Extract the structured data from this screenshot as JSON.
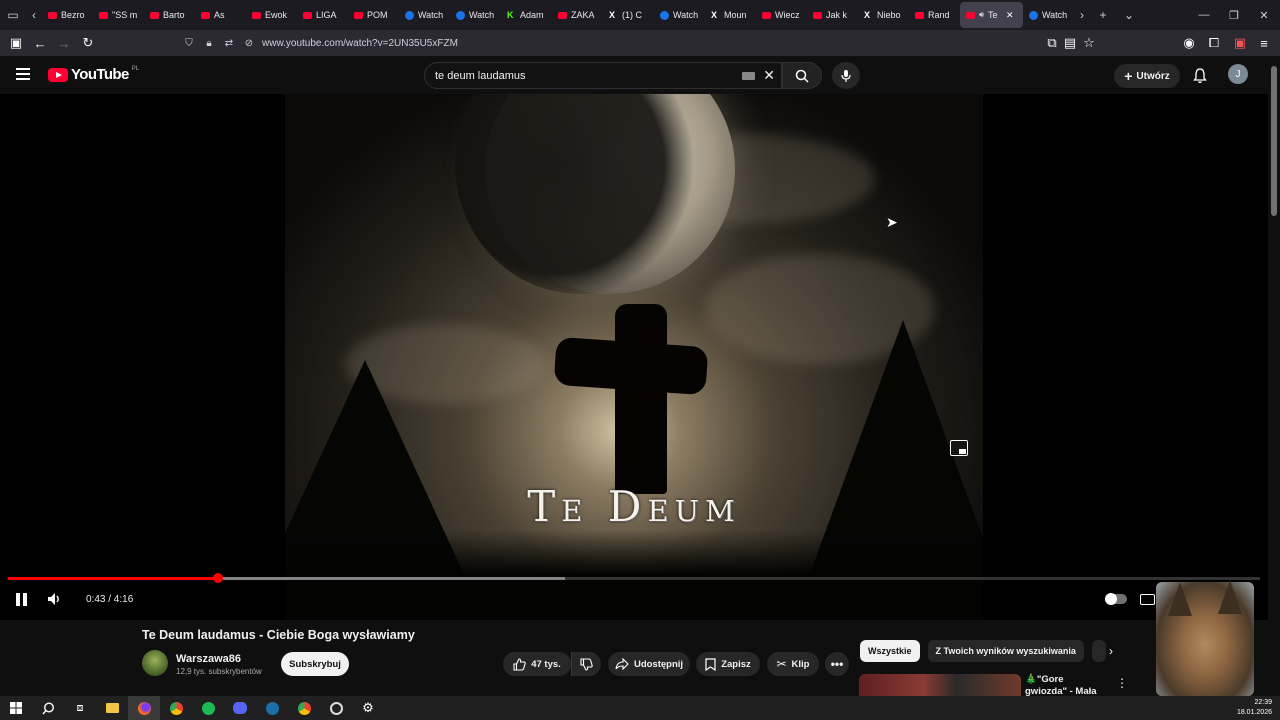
{
  "browser": {
    "tabs": [
      {
        "label": "Bezro",
        "favicon": "yt"
      },
      {
        "label": "\"SS m",
        "favicon": "yt"
      },
      {
        "label": "Barto",
        "favicon": "yt"
      },
      {
        "label": "As",
        "favicon": "yt"
      },
      {
        "label": "Ewok",
        "favicon": "yt"
      },
      {
        "label": "LIGA",
        "favicon": "yt"
      },
      {
        "label": "POM",
        "favicon": "yt"
      },
      {
        "label": "Watch",
        "favicon": "blue"
      },
      {
        "label": "Watch",
        "favicon": "blue"
      },
      {
        "label": "Adam",
        "favicon": "k"
      },
      {
        "label": "ZAKA",
        "favicon": "yt"
      },
      {
        "label": "(1) C",
        "favicon": "x"
      },
      {
        "label": "Watch",
        "favicon": "blue"
      },
      {
        "label": "Moun",
        "favicon": "x"
      },
      {
        "label": "Wiecz",
        "favicon": "yt"
      },
      {
        "label": "Jak k",
        "favicon": "yt"
      },
      {
        "label": "Niebo",
        "favicon": "x"
      },
      {
        "label": "Rand",
        "favicon": "yt"
      },
      {
        "label": "Te",
        "favicon": "yt",
        "active": true
      },
      {
        "label": "Watch",
        "favicon": "blue"
      }
    ],
    "url": "www.youtube.com/watch?v=2UN35U5xFZM"
  },
  "yt": {
    "logo_text": "YouTube",
    "country": "PL",
    "search_value": "te deum laudamus",
    "create_label": "Utwórz",
    "avatar_letter": "J"
  },
  "player": {
    "overlay_title": "Te Deum",
    "current_time": "0:43",
    "duration": "4:16",
    "time_display": "0:43 / 4:16",
    "progress_fraction": 0.168,
    "buffered_fraction": 0.445
  },
  "video": {
    "title": "Te Deum laudamus - Ciebie Boga wysławiamy",
    "channel": "Warszawa86",
    "subscribers": "12,9 tys. subskrybentów",
    "subscribe_label": "Subskrybuj",
    "likes": "47 tys.",
    "share_label": "Udostępnij",
    "save_label": "Zapisz",
    "clip_label": "Klip"
  },
  "sidebar": {
    "chips": [
      "Wszystkie",
      "Z Twoich wyników wyszukiwania"
    ],
    "rec_title": "🎄\"Gore gwiozda\" - Mała Armia"
  },
  "system": {
    "time": "22:39",
    "date": "18.01.2026"
  },
  "colors": {
    "accent": "#ff0033",
    "progress": "#ff0000",
    "background": "#0f0f0f"
  }
}
